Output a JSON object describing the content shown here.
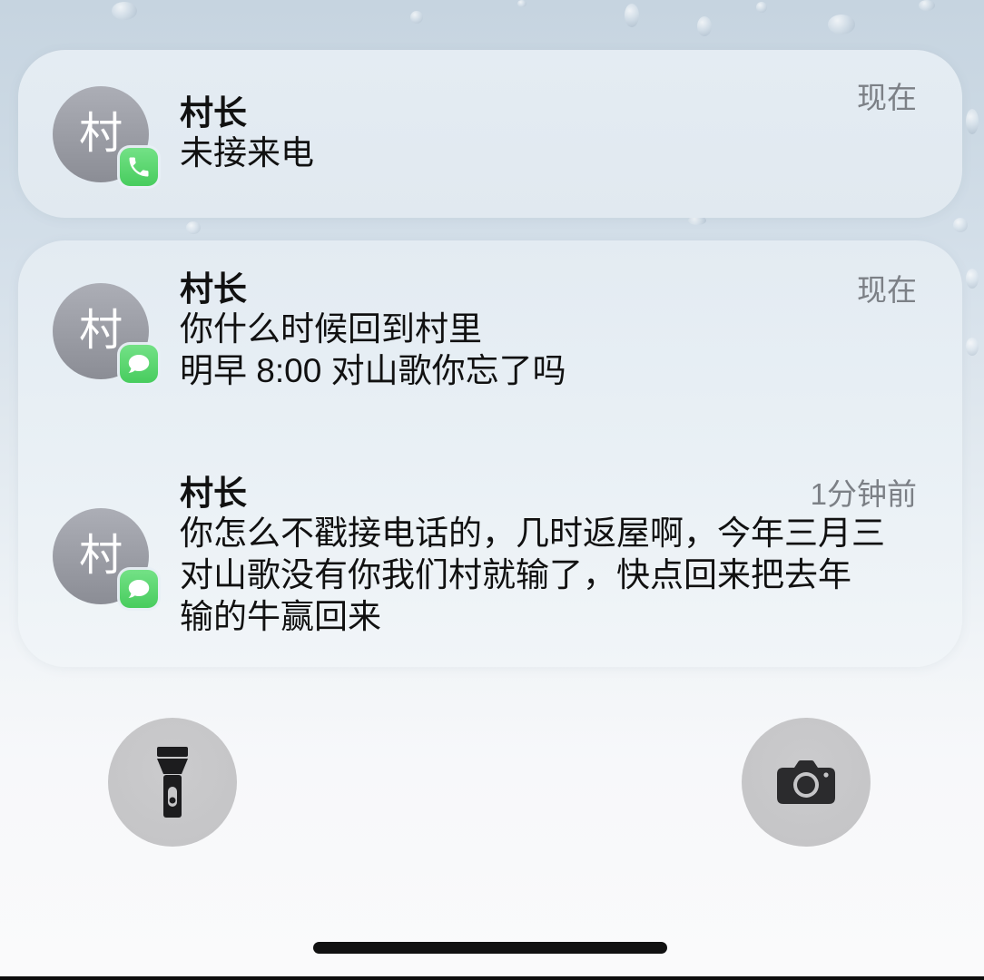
{
  "notifications": {
    "missed_call": {
      "avatar_initial": "村",
      "sender": "村长",
      "time": "现在",
      "body_lines": [
        "未接来电"
      ],
      "app_icon": "phone-icon"
    },
    "messages": [
      {
        "avatar_initial": "村",
        "sender": "村长",
        "time": "现在",
        "body_lines": [
          "你什么时候回到村里",
          "明早 8:00 对山歌你忘了吗"
        ],
        "app_icon": "message-bubble-icon"
      },
      {
        "avatar_initial": "村",
        "sender": "村长",
        "time": "1分钟前",
        "body_lines": [
          "你怎么不戳接电话的，几时返屋啊，今年三月三",
          "对山歌没有你我们村就输了，快点回来把去年",
          "输的牛赢回来"
        ],
        "app_icon": "message-bubble-icon"
      }
    ]
  },
  "quick_actions": [
    {
      "icon": "flashlight-icon"
    },
    {
      "icon": "camera-icon"
    }
  ],
  "colors": {
    "app_badge_green": "#4cd964",
    "avatar_gray": "#8b8d95",
    "primary_text": "#111111",
    "secondary_text": "#7c8086",
    "home_indicator": "#111111"
  }
}
